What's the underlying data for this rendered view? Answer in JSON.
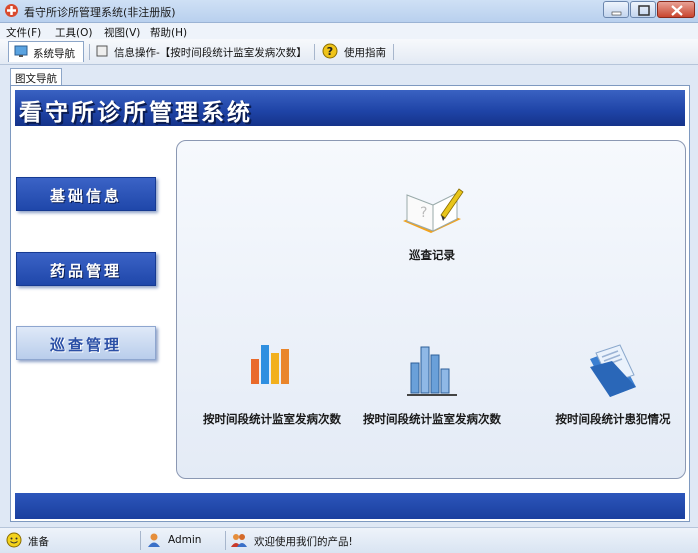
{
  "window": {
    "title": "看守所诊所管理系统(非注册版)"
  },
  "menu": {
    "items": [
      "文件(F)",
      "工具(O)",
      "视图(V)",
      "帮助(H)"
    ]
  },
  "toolbar": {
    "nav_label": "系统导航",
    "info_label": "信息操作-【按时间段统计监室发病次数】",
    "guide_label": "使用指南"
  },
  "tabs": {
    "graphic_nav": "图文导航"
  },
  "banner": {
    "title": "看守所诊所管理系统"
  },
  "nav": {
    "items": [
      "基础信息",
      "药品管理",
      "巡查管理"
    ],
    "selected": "巡查管理"
  },
  "functions": {
    "patrol": "巡查记录",
    "by_time": "按时间段统计监室发病次数",
    "by_time_cell": "按时间段统计监室发病次数",
    "by_time_prisoner": "按时间段统计患犯情况"
  },
  "status": {
    "ready": "准备",
    "user": "Admin",
    "welcome": "欢迎使用我们的产品!"
  },
  "colors": {
    "accent": "#1f47aa",
    "panel": "#e4ebf6"
  }
}
